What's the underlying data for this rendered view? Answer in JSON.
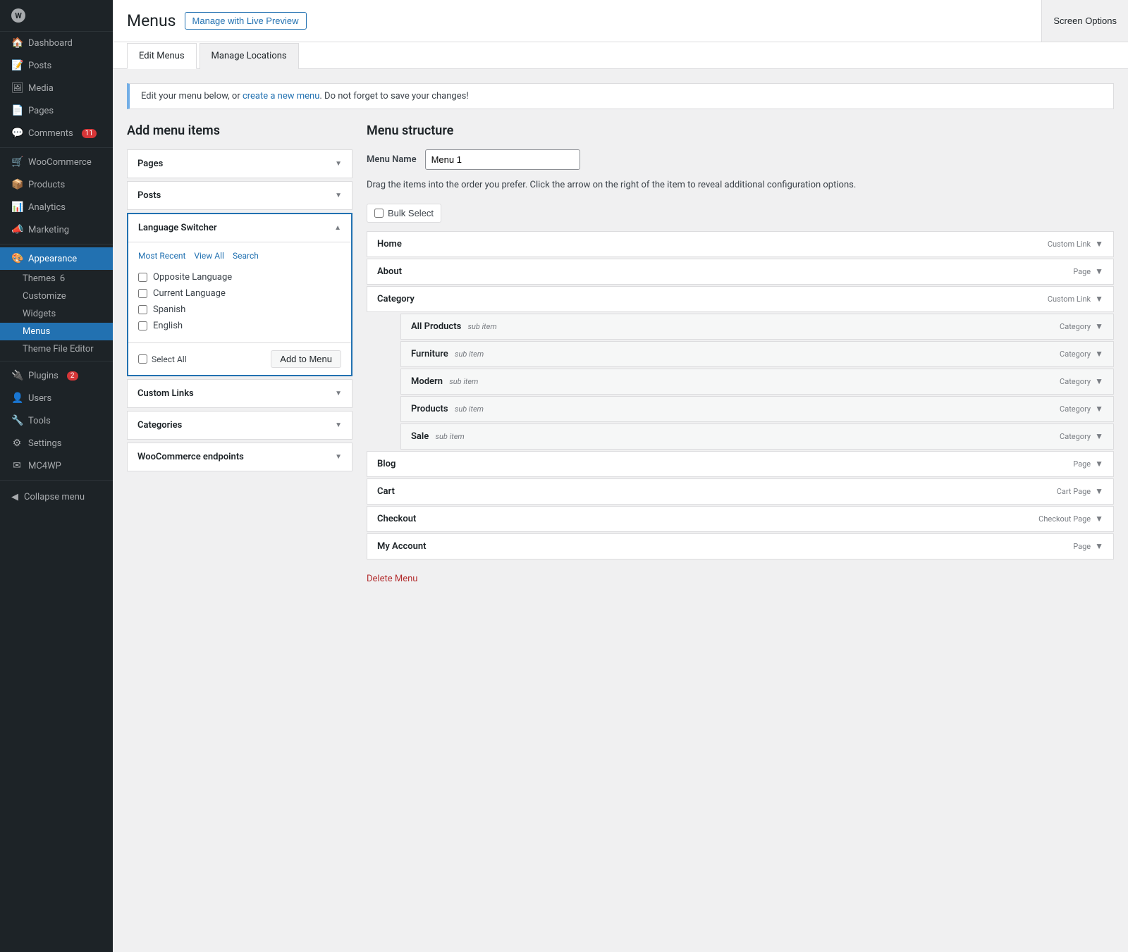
{
  "sidebar": {
    "items": [
      {
        "id": "dashboard",
        "label": "Dashboard",
        "icon": "🏠",
        "badge": null
      },
      {
        "id": "posts",
        "label": "Posts",
        "icon": "📝",
        "badge": null
      },
      {
        "id": "media",
        "label": "Media",
        "icon": "🖼",
        "badge": null
      },
      {
        "id": "pages",
        "label": "Pages",
        "icon": "📄",
        "badge": null
      },
      {
        "id": "comments",
        "label": "Comments",
        "icon": "💬",
        "badge": "11"
      },
      {
        "id": "woocommerce",
        "label": "WooCommerce",
        "icon": "🛒",
        "badge": null
      },
      {
        "id": "products",
        "label": "Products",
        "icon": "📦",
        "badge": null
      },
      {
        "id": "analytics",
        "label": "Analytics",
        "icon": "📊",
        "badge": null
      },
      {
        "id": "marketing",
        "label": "Marketing",
        "icon": "📣",
        "badge": null
      },
      {
        "id": "appearance",
        "label": "Appearance",
        "icon": "🎨",
        "badge": null,
        "active": true
      }
    ],
    "appearance_sub": [
      {
        "id": "themes",
        "label": "Themes",
        "badge": "6"
      },
      {
        "id": "customize",
        "label": "Customize",
        "badge": null
      },
      {
        "id": "widgets",
        "label": "Widgets",
        "badge": null
      },
      {
        "id": "menus",
        "label": "Menus",
        "badge": null,
        "active": true
      },
      {
        "id": "theme-file-editor",
        "label": "Theme File Editor",
        "badge": null
      }
    ],
    "bottom_items": [
      {
        "id": "plugins",
        "label": "Plugins",
        "icon": "🔌",
        "badge": "2"
      },
      {
        "id": "users",
        "label": "Users",
        "icon": "👤",
        "badge": null
      },
      {
        "id": "tools",
        "label": "Tools",
        "icon": "🔧",
        "badge": null
      },
      {
        "id": "settings",
        "label": "Settings",
        "icon": "⚙",
        "badge": null
      },
      {
        "id": "mc4wp",
        "label": "MC4WP",
        "icon": "✉",
        "badge": null
      }
    ],
    "collapse_label": "Collapse menu"
  },
  "topbar": {
    "title": "Menus",
    "live_preview_btn": "Manage with Live Preview",
    "screen_options_btn": "Screen Options"
  },
  "tabs": [
    {
      "id": "edit-menus",
      "label": "Edit Menus",
      "active": true
    },
    {
      "id": "manage-locations",
      "label": "Manage Locations",
      "active": false
    }
  ],
  "notice": {
    "text_before": "Edit your menu below, or ",
    "link_text": "create a new menu",
    "text_after": ". Do not forget to save your changes!"
  },
  "add_items": {
    "title": "Add menu items",
    "panels": [
      {
        "id": "pages",
        "label": "Pages",
        "open": false
      },
      {
        "id": "posts",
        "label": "Posts",
        "open": false
      },
      {
        "id": "language-switcher",
        "label": "Language Switcher",
        "open": true,
        "tabs": [
          {
            "id": "most-recent",
            "label": "Most Recent",
            "active": true
          },
          {
            "id": "view-all",
            "label": "View All",
            "active": false
          },
          {
            "id": "search",
            "label": "Search",
            "active": false
          }
        ],
        "checkboxes": [
          {
            "id": "opposite-language",
            "label": "Opposite Language"
          },
          {
            "id": "current-language",
            "label": "Current Language"
          },
          {
            "id": "spanish",
            "label": "Spanish"
          },
          {
            "id": "english",
            "label": "English"
          }
        ],
        "select_all_label": "Select All",
        "add_to_menu_btn": "Add to Menu"
      },
      {
        "id": "custom-links",
        "label": "Custom Links",
        "open": false
      },
      {
        "id": "categories",
        "label": "Categories",
        "open": false
      },
      {
        "id": "woocommerce-endpoints",
        "label": "WooCommerce endpoints",
        "open": false
      }
    ]
  },
  "menu_structure": {
    "title": "Menu structure",
    "name_label": "Menu Name",
    "name_value": "Menu 1",
    "drag_hint": "Drag the items into the order you prefer. Click the arrow on the right of the item to reveal additional configuration options.",
    "bulk_select_btn": "Bulk Select",
    "items": [
      {
        "id": "home",
        "label": "Home",
        "type": "Custom Link",
        "sub": false
      },
      {
        "id": "about",
        "label": "About",
        "type": "Page",
        "sub": false
      },
      {
        "id": "category",
        "label": "Category",
        "type": "Custom Link",
        "sub": false
      },
      {
        "id": "all-products",
        "label": "All Products",
        "type": "Category",
        "sub": true,
        "sub_tag": "sub item"
      },
      {
        "id": "furniture",
        "label": "Furniture",
        "type": "Category",
        "sub": true,
        "sub_tag": "sub item"
      },
      {
        "id": "modern",
        "label": "Modern",
        "type": "Category",
        "sub": true,
        "sub_tag": "sub item"
      },
      {
        "id": "products",
        "label": "Products",
        "type": "Category",
        "sub": true,
        "sub_tag": "sub item"
      },
      {
        "id": "sale",
        "label": "Sale",
        "type": "Category",
        "sub": true,
        "sub_tag": "sub item"
      },
      {
        "id": "blog",
        "label": "Blog",
        "type": "Page",
        "sub": false
      },
      {
        "id": "cart",
        "label": "Cart",
        "type": "Cart Page",
        "sub": false
      },
      {
        "id": "checkout",
        "label": "Checkout",
        "type": "Checkout Page",
        "sub": false
      },
      {
        "id": "my-account",
        "label": "My Account",
        "type": "Page",
        "sub": false
      }
    ],
    "delete_menu_label": "Delete Menu"
  }
}
